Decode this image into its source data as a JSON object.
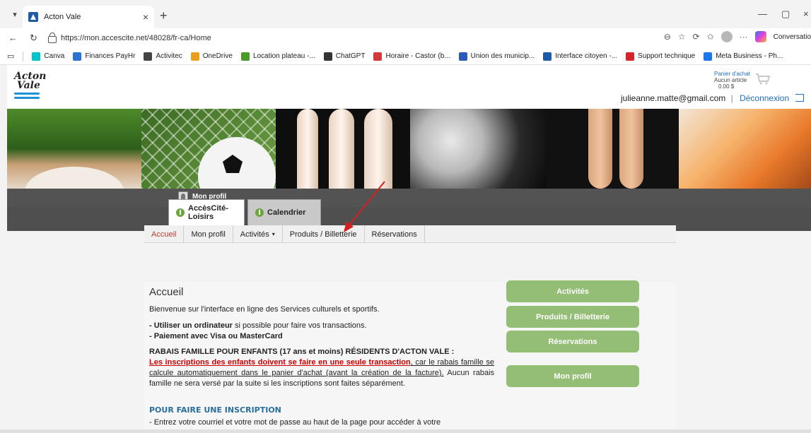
{
  "browser": {
    "tab_title": "Acton Vale",
    "new_tab": "+",
    "close_tab": "×",
    "url": "https://mon.accescite.net/48028/fr-ca/Home",
    "copilot_label": "Conversatio",
    "bookmarks": [
      "Canva",
      "Finances PayHr",
      "Activitec",
      "OneDrive",
      "Location plateau -...",
      "ChatGPT",
      "Horaire - Castor (b...",
      "Union des municip...",
      "Interface citoyen -...",
      "Support technique",
      "Meta Business - Ph..."
    ],
    "bookmark_colors": [
      "#00c4cc",
      "#2a72d8",
      "#444444",
      "#e8a022",
      "#4a9a2a",
      "#333333",
      "#d23b3b",
      "#2a5bb8",
      "#1e5aa8",
      "#d8232a",
      "#1877f2"
    ]
  },
  "header": {
    "logo_line1": "Acton",
    "logo_line2": "Vale",
    "cart_title": "Panier d'achat",
    "cart_items": "Aucun article",
    "cart_total": "0.00 $",
    "user_email": "julieanne.matte@gmail.com",
    "separator": "|",
    "logout": "Déconnexion"
  },
  "profile_strip": {
    "label": "Mon profil"
  },
  "app_tabs": [
    {
      "label": "AccèsCité-Loisirs",
      "active": true
    },
    {
      "label": "Calendrier",
      "active": false
    }
  ],
  "subnav": [
    {
      "label": "Accueil",
      "active": true
    },
    {
      "label": "Mon profil",
      "active": false
    },
    {
      "label": "Activités",
      "active": false,
      "caret": "▾"
    },
    {
      "label": "Produits / Billetterie",
      "active": false
    },
    {
      "label": "Réservations",
      "active": false
    }
  ],
  "main": {
    "title": "Accueil",
    "intro": "Bienvenue sur l'interface en ligne des Services culturels et sportifs.",
    "bullet1_strong": "- Utiliser un ordinateur",
    "bullet1_rest": " si possible pour faire vos transactions.",
    "bullet2": "- Paiement avec Visa ou MasterCard",
    "rabais_title": "RABAIS FAMILLE POUR ENFANTS (17 ans et moins) RÉSIDENTS D'ACTON VALE :",
    "rabais_red": "Les inscriptions des enfants doivent se faire en une seule transaction",
    "rabais_under": ", car le rabais famille se calcule automatiquement dans le panier d'achat (avant la création de la facture).",
    "rabais_rest": " Aucun rabais famille ne sera versé par la suite si les inscriptions sont faites séparément.",
    "section_title": "POUR FAIRE UNE INSCRIPTION",
    "step1": "- Entrez votre courriel et votre mot de passe au haut de la page pour accéder à votre"
  },
  "side_buttons": {
    "activites": "Activités",
    "produits": "Produits / Billetterie",
    "reservations": "Réservations",
    "mon_profil": "Mon profil"
  },
  "colors": {
    "accent_green": "#94be76",
    "link_blue": "#1e6fbf",
    "active_red": "#c0392b",
    "section_blue": "#2a6f9b"
  }
}
